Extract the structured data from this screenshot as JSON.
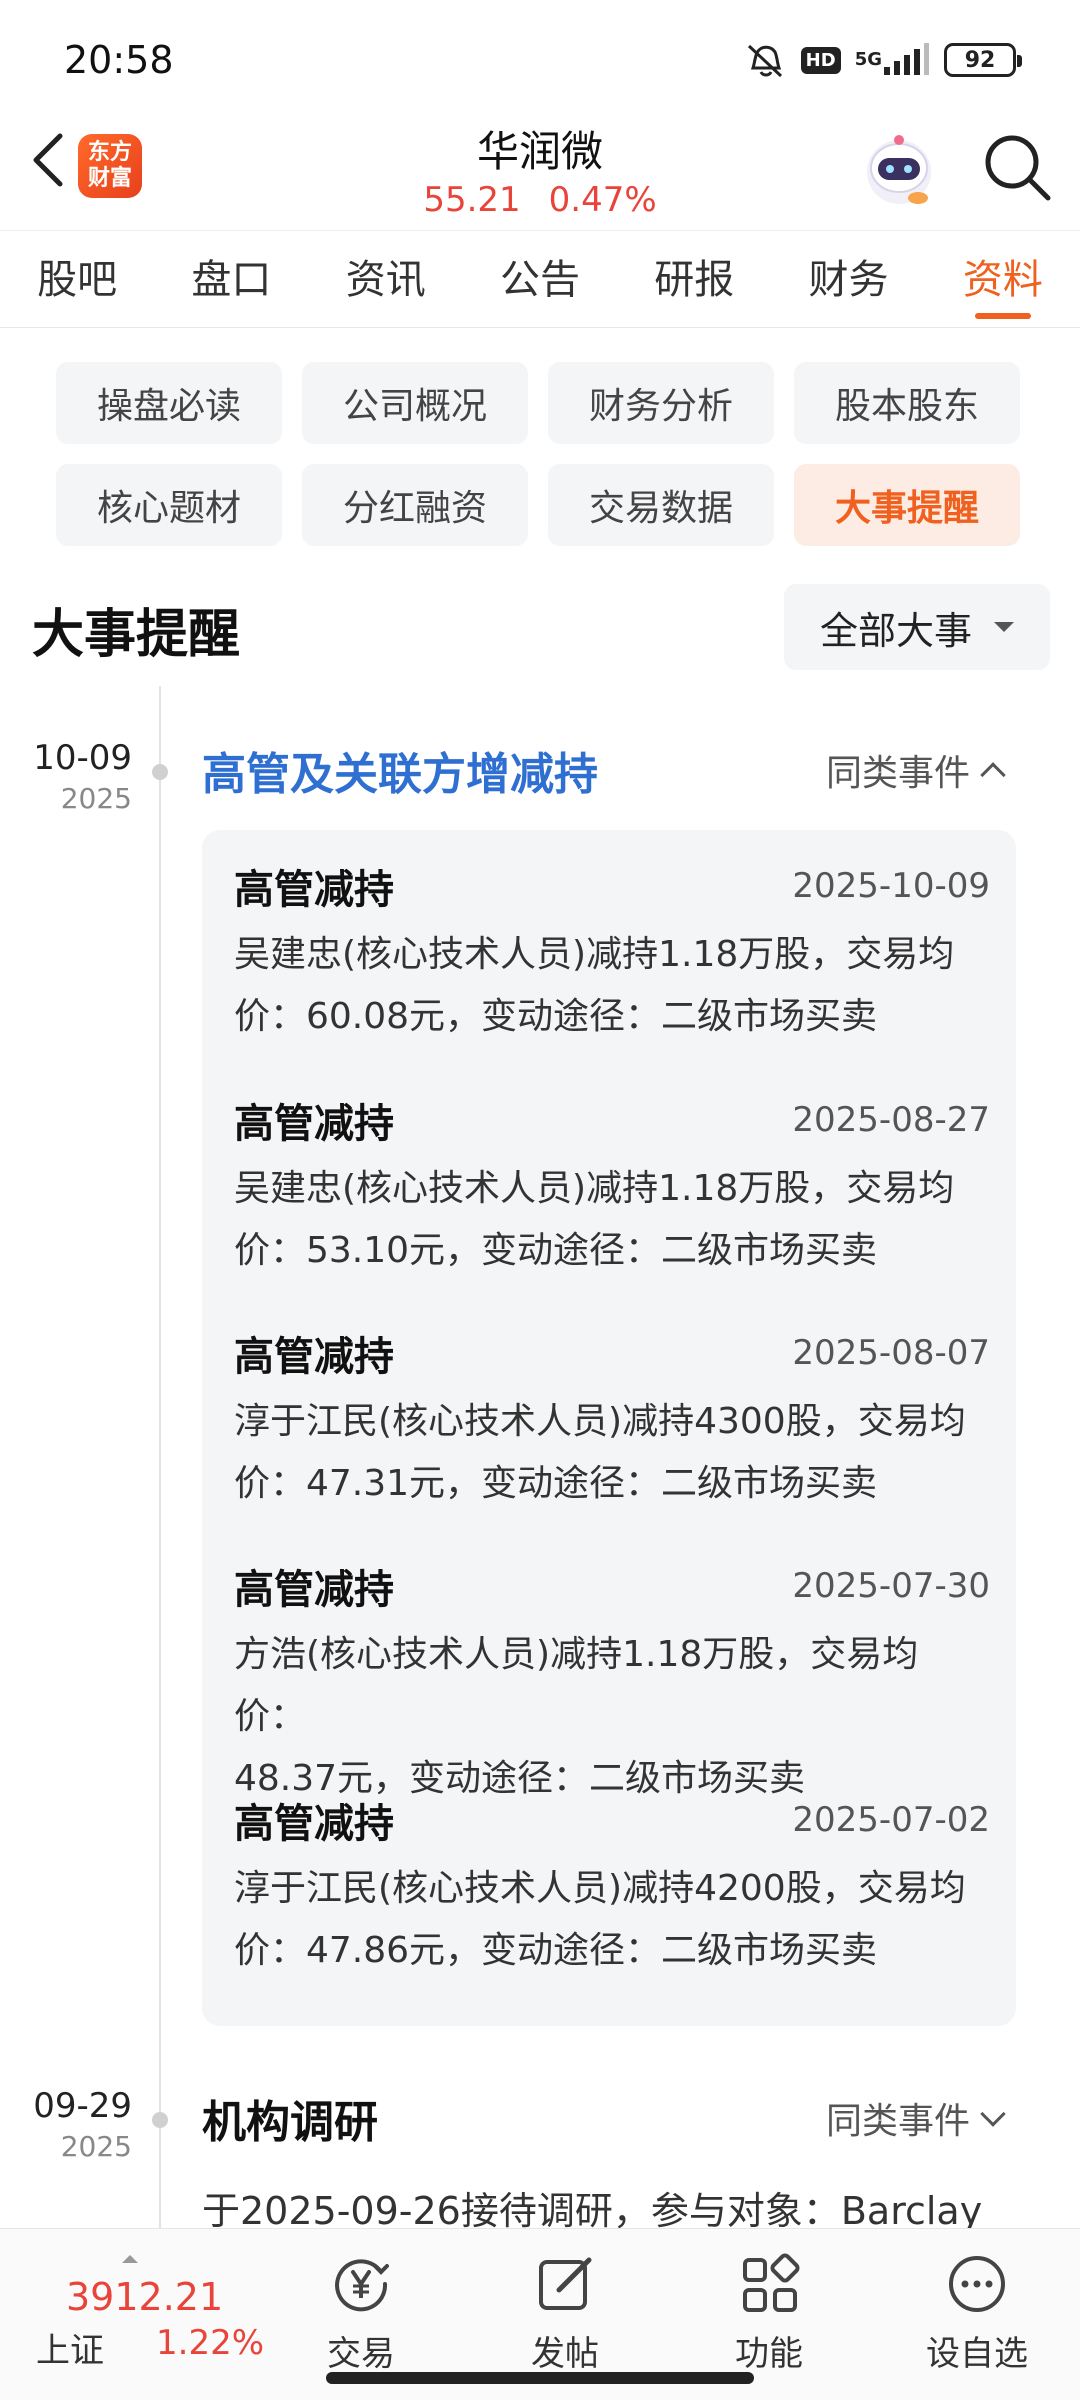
{
  "status_bar": {
    "time": "20:58",
    "hd": "HD",
    "network": "5G",
    "battery": "92"
  },
  "header": {
    "logo_line1": "东方",
    "logo_line2": "财富",
    "stock_name": "华润微",
    "price": "55.21",
    "change_pct": "0.47%"
  },
  "tabs": [
    {
      "label": "股吧"
    },
    {
      "label": "盘口"
    },
    {
      "label": "资讯"
    },
    {
      "label": "公告"
    },
    {
      "label": "研报"
    },
    {
      "label": "财务"
    },
    {
      "label": "资料"
    }
  ],
  "subtabs": [
    {
      "label": "操盘必读"
    },
    {
      "label": "公司概况"
    },
    {
      "label": "财务分析"
    },
    {
      "label": "股本股东"
    },
    {
      "label": "核心题材"
    },
    {
      "label": "分红融资"
    },
    {
      "label": "交易数据"
    },
    {
      "label": "大事提醒"
    }
  ],
  "section": {
    "title": "大事提醒",
    "filter_label": "全部大事"
  },
  "events": [
    {
      "month_day": "10-09",
      "year": "2025",
      "title": "高管及关联方增减持",
      "similar_label": "同类事件",
      "details": [
        {
          "type": "高管减持",
          "date": "2025-10-09",
          "line1": "吴建忠(核心技术人员)减持1.18万股，交易均",
          "line2": "价：60.08元，变动途径：二级市场买卖"
        },
        {
          "type": "高管减持",
          "date": "2025-08-27",
          "line1": "吴建忠(核心技术人员)减持1.18万股，交易均",
          "line2": "价：53.10元，变动途径：二级市场买卖"
        },
        {
          "type": "高管减持",
          "date": "2025-08-07",
          "line1": "淳于江民(核心技术人员)减持4300股，交易均",
          "line2": "价：47.31元，变动途径：二级市场买卖"
        },
        {
          "type": "高管减持",
          "date": "2025-07-30",
          "line1": "方浩(核心技术人员)减持1.18万股，交易均价：",
          "line2": "48.37元，变动途径：二级市场买卖"
        },
        {
          "type": "高管减持",
          "date": "2025-07-02",
          "line1": "淳于江民(核心技术人员)减持4200股，交易均",
          "line2": "价：47.86元，变动途径：二级市场买卖"
        }
      ]
    },
    {
      "month_day": "09-29",
      "year": "2025",
      "title": "机构调研",
      "similar_label": "同类事件",
      "summary": "于2025-09-26接待调研，参与对象：Barclay"
    }
  ],
  "bottom_nav": {
    "index_value": "3912.21",
    "index_name": "上证",
    "index_change": "1.22%",
    "items": [
      {
        "label": "交易",
        "icon": "yen-circle-icon"
      },
      {
        "label": "发帖",
        "icon": "edit-icon"
      },
      {
        "label": "功能",
        "icon": "grid-icon"
      },
      {
        "label": "设自选",
        "icon": "more-circle-icon"
      }
    ]
  },
  "colors": {
    "accent": "#f0601e",
    "up_red": "#e8443a",
    "link_blue": "#2f6fd1"
  }
}
